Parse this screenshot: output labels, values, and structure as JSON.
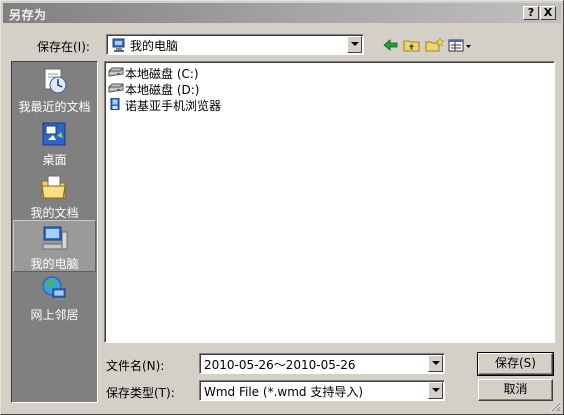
{
  "window": {
    "title": "另存为"
  },
  "titlebar": {
    "help_label": "?",
    "close_label": "X"
  },
  "location": {
    "label": "保存在(I):",
    "value": "我的电脑"
  },
  "places": [
    {
      "label": "我最近的文档",
      "icon": "recent-documents-icon"
    },
    {
      "label": "桌面",
      "icon": "desktop-icon"
    },
    {
      "label": "我的文档",
      "icon": "my-documents-icon"
    },
    {
      "label": "我的电脑",
      "icon": "my-computer-icon",
      "selected": true
    },
    {
      "label": "网上邻居",
      "icon": "network-places-icon"
    }
  ],
  "files": [
    {
      "name": "本地磁盘 (C:)",
      "icon": "drive-icon"
    },
    {
      "name": "本地磁盘 (D:)",
      "icon": "drive-icon"
    },
    {
      "name": "诺基亚手机浏览器",
      "icon": "phone-browser-icon"
    }
  ],
  "filename": {
    "label": "文件名(N):",
    "value": "2010-05-26～2010-05-26"
  },
  "filetype": {
    "label": "保存类型(T):",
    "value": "Wmd File (*.wmd 支持导入)"
  },
  "buttons": {
    "save": "保存(S)",
    "cancel": "取消"
  }
}
